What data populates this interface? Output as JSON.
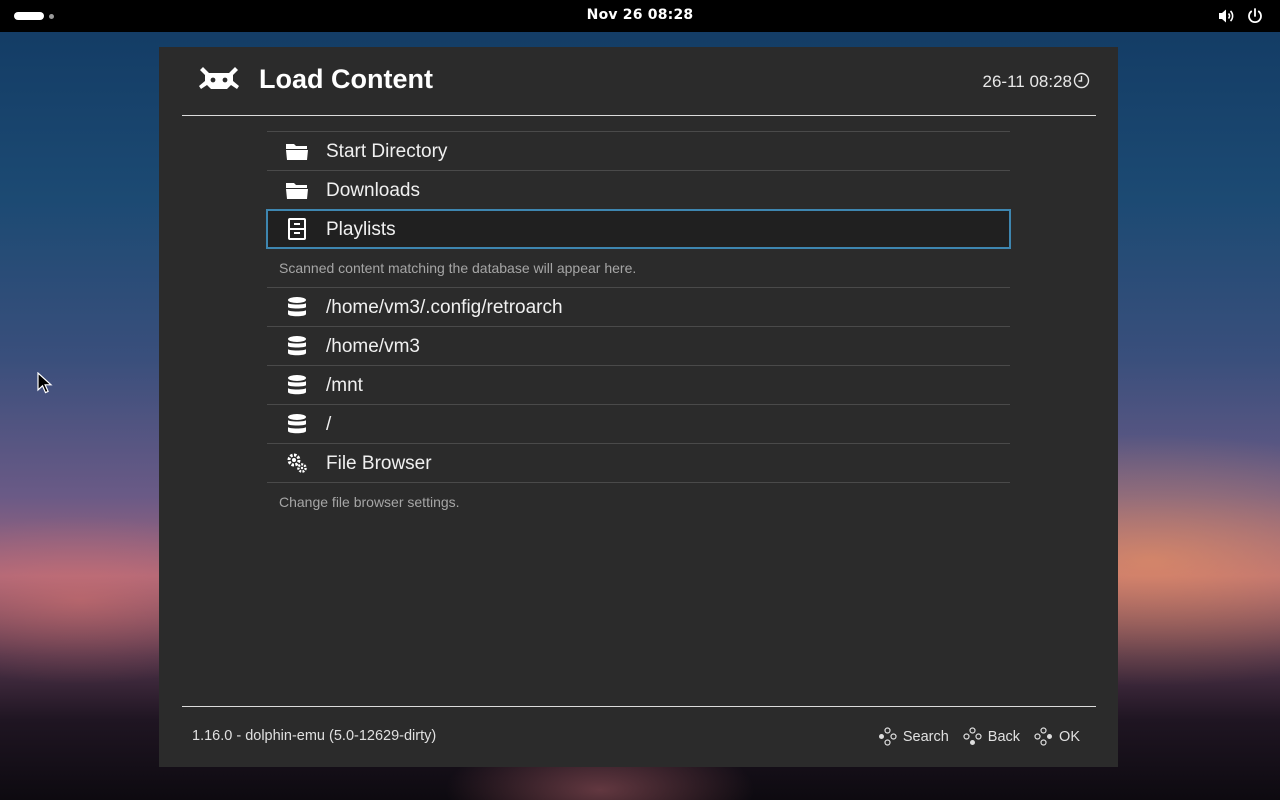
{
  "topbar": {
    "clock": "Nov 26  08:28",
    "icons": [
      "activities-indicator",
      "volume-icon",
      "power-icon"
    ]
  },
  "window": {
    "title": "Load Content",
    "datetime": "26-11 08:28",
    "list": [
      {
        "label": "Start Directory",
        "icon": "folder-icon"
      },
      {
        "label": "Downloads",
        "icon": "folder-icon"
      },
      {
        "label": "Playlists",
        "icon": "cabinet-icon",
        "selected": true,
        "sublabel": "Scanned content matching the database will appear here."
      },
      {
        "label": "/home/vm3/.config/retroarch",
        "icon": "database-icon"
      },
      {
        "label": "/home/vm3",
        "icon": "database-icon"
      },
      {
        "label": "/mnt",
        "icon": "database-icon"
      },
      {
        "label": "/",
        "icon": "database-icon"
      },
      {
        "label": "File Browser",
        "icon": "settings-gears-icon",
        "sublabel": "Change file browser settings."
      }
    ],
    "footer": {
      "version": "1.16.0 - dolphin-emu (5.0-12629-dirty)",
      "actions": [
        {
          "label": "Search",
          "icon": "gamepad-buttons-icon"
        },
        {
          "label": "Back",
          "icon": "gamepad-buttons-icon"
        },
        {
          "label": "OK",
          "icon": "gamepad-buttons-icon"
        }
      ]
    }
  },
  "colors": {
    "selection_border": "#3e86b0",
    "window_bg": "#2b2b2b",
    "topbar_bg": "#000000"
  }
}
